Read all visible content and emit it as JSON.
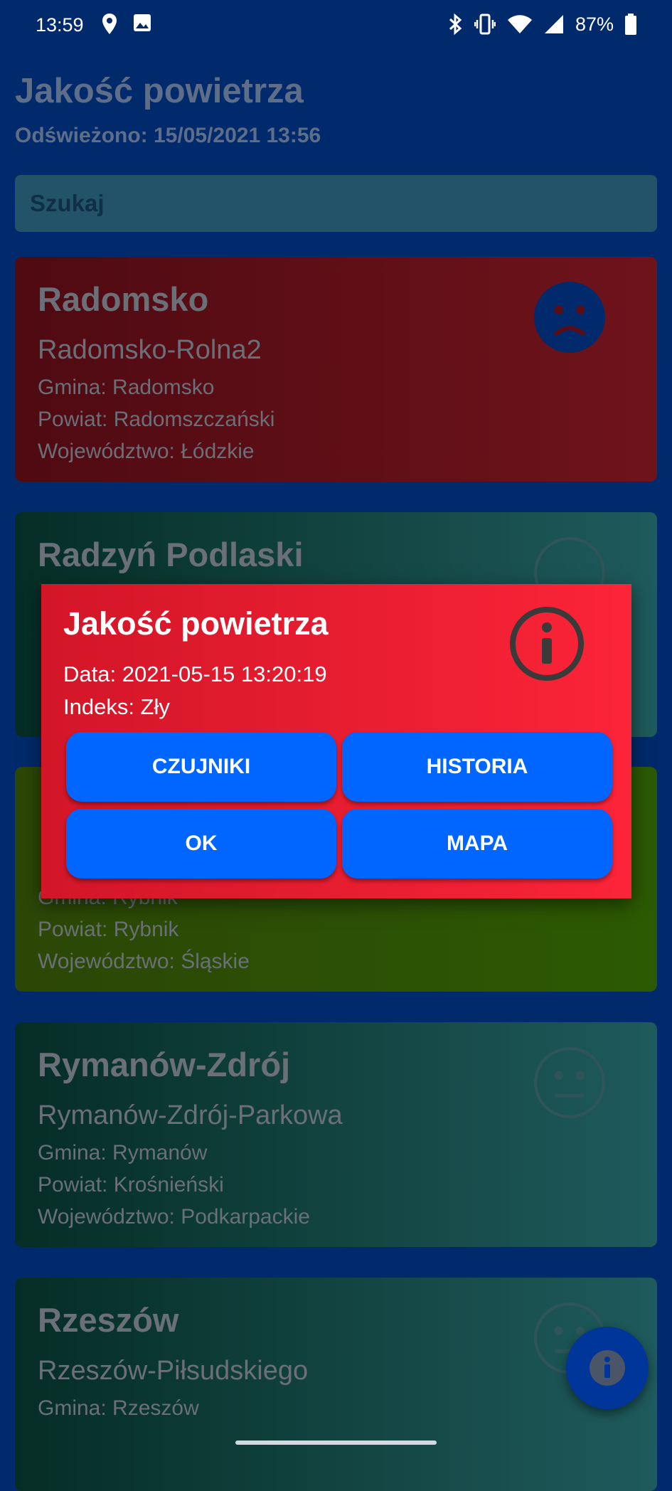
{
  "status_bar": {
    "time": "13:59",
    "battery": "87%",
    "left_icons": [
      "location-icon",
      "image-icon"
    ],
    "right_icons": [
      "bluetooth-icon",
      "vibrate-icon",
      "wifi-icon",
      "cell-signal-icon",
      "battery-icon"
    ]
  },
  "header": {
    "title": "Jakość powietrza",
    "refreshed": "Odświeżono: 15/05/2021 13:56"
  },
  "search": {
    "placeholder": "Szukaj"
  },
  "stations": [
    {
      "city": "Radomsko",
      "station": "Radomsko-Rolna2",
      "gmina": "Gmina: Radomsko",
      "powiat": "Powiat: Radomszczański",
      "wojewodztwo": "Województwo: Łódzkie",
      "face": "sad-face-icon",
      "color_start": "#4f0a12",
      "color_end": "#6f131b"
    },
    {
      "city": "Radzyń Podlaski",
      "face": "neutral-face-icon",
      "color_start": "#052d25",
      "color_end": "#1f5a5c"
    },
    {
      "city": "",
      "gmina": "Gmina: Rybnik",
      "powiat": "Powiat: Rybnik",
      "wojewodztwo": "Województwo: Śląskie",
      "color_start": "#2c4606",
      "color_end": "#2c5a03"
    },
    {
      "city": "Rymanów-Zdrój",
      "station": "Rymanów-Zdrój-Parkowa",
      "gmina": "Gmina: Rymanów",
      "powiat": "Powiat: Krośnieński",
      "wojewodztwo": "Województwo: Podkarpackie",
      "face": "neutral-face-icon",
      "color_start": "#052d25",
      "color_end": "#1f5a5c"
    },
    {
      "city": "Rzeszów",
      "station": "Rzeszów-Piłsudskiego",
      "gmina": "Gmina: Rzeszów",
      "face": "neutral-face-icon",
      "color_start": "#052d25",
      "color_end": "#1f5a5c"
    }
  ],
  "dialog": {
    "title": "Jakość powietrza",
    "date": "Data: 2021-05-15 13:20:19",
    "index": "Indeks: Zły",
    "icon": "info-circle-icon",
    "buttons": {
      "sensors": "CZUJNIKI",
      "history": "HISTORIA",
      "ok": "OK",
      "map": "MAPA"
    }
  },
  "fab": {
    "icon": "info-icon"
  },
  "colors": {
    "background": "#002a6b",
    "muted_text": "#5e6e89",
    "dialog_red": "#fc2438",
    "button_blue": "#0066ff"
  }
}
